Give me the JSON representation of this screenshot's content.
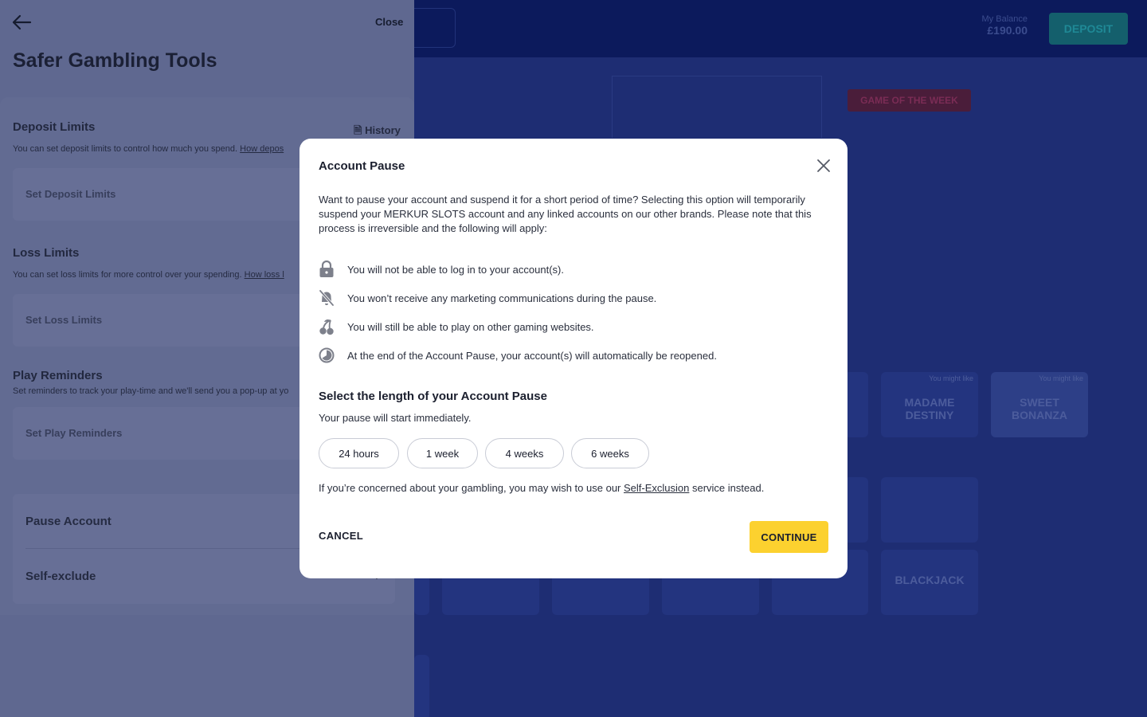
{
  "site": {
    "balance_label": "My Balance",
    "balance_amount": "£190.00",
    "deposit_label": "DEPOSIT",
    "game_of_week": "GAME OF THE WEEK",
    "tiles": [
      {
        "tag": "You might like",
        "title": "MADAME DESTINY"
      },
      {
        "tag": "You might like",
        "title": "SWEET BONANZA"
      },
      {
        "tag": "",
        "title": "BLACKJACK"
      }
    ]
  },
  "drawer": {
    "close_label": "Close",
    "title": "Safer Gambling Tools",
    "history_label": "History",
    "deposit": {
      "title": "Deposit Limits",
      "desc": "You can set deposit limits to control how much you spend.",
      "link": "How depos",
      "field": "Set Deposit Limits"
    },
    "loss": {
      "title": "Loss Limits",
      "desc": "You can set loss limits for more control over your spending.",
      "link": "How loss l",
      "field": "Set Loss Limits"
    },
    "reminders": {
      "title": "Play Reminders",
      "desc": "Set reminders to track your play-time and we'll send you a pop-up at yo",
      "field": "Set Play Reminders"
    },
    "pause_label": "Pause Account",
    "self_exclude_label": "Self-exclude"
  },
  "modal": {
    "title": "Account Pause",
    "intro": "Want to pause your account and suspend it for a short period of time? Selecting this option will temporarily suspend your MERKUR SLOTS account and any linked accounts on our other brands. Please note that this process is irreversible and the following will apply:",
    "rules": [
      {
        "icon": "lock-icon",
        "text": "You will not be able to log in to your account(s)."
      },
      {
        "icon": "bell-off-icon",
        "text": "You won’t receive any marketing communications during the pause."
      },
      {
        "icon": "cherries-icon",
        "text": "You will still be able to play on other gaming websites."
      },
      {
        "icon": "timer-icon",
        "text": "At the end of the Account Pause, your account(s) will automatically be reopened."
      }
    ],
    "length_title": "Select the length of your Account Pause",
    "length_desc": "Your pause will start immediately.",
    "options": [
      "24 hours",
      "1 week",
      "4 weeks",
      "6 weeks"
    ],
    "concern_prefix": "If you’re concerned about your gambling, you may wish to use our ",
    "concern_link": "Self-Exclusion",
    "concern_suffix": " service instead.",
    "cancel_label": "CANCEL",
    "continue_label": "CONTINUE"
  }
}
